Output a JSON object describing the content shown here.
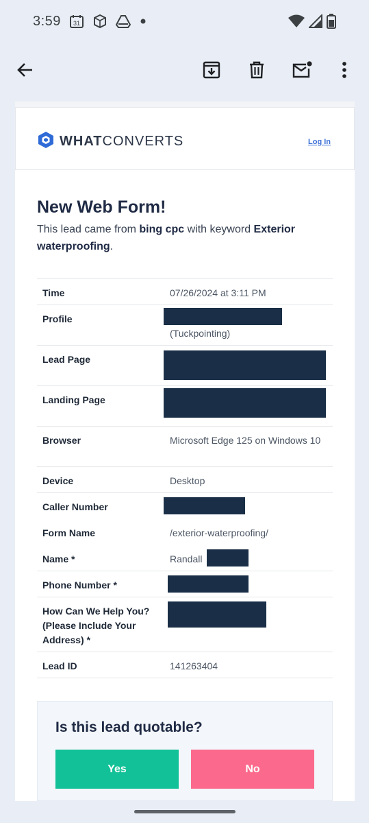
{
  "status_bar": {
    "time": "3:59",
    "calendar_day": "31",
    "icons": [
      "calendar-icon",
      "box-icon",
      "drive-icon",
      "dot-icon",
      "wifi-icon",
      "signal-icon",
      "battery-icon"
    ]
  },
  "toolbar": {
    "icons": [
      "back-arrow-icon",
      "archive-icon",
      "delete-icon",
      "mark-unread-icon",
      "more-vert-icon"
    ]
  },
  "header": {
    "brand_bold": "WHAT",
    "brand_rest": "CONVERTS",
    "login": "Log In"
  },
  "email": {
    "title": "New Web Form!",
    "intro_prefix": "This lead came from ",
    "source": "bing cpc",
    "intro_mid": " with keyword ",
    "keyword": "Exterior waterproofing",
    "intro_suffix": "."
  },
  "details": {
    "time_label": "Time",
    "time_value": "07/26/2024 at 3:11 PM",
    "profile_label": "Profile",
    "profile_value": "(Tuckpointing)",
    "lead_page_label": "Lead Page",
    "landing_page_label": "Landing Page",
    "browser_label": "Browser",
    "browser_value": "Microsoft Edge 125 on Windows 10",
    "device_label": "Device",
    "device_value": "Desktop",
    "caller_label": "Caller Number",
    "form_name_label": "Form Name",
    "form_name_value": "/exterior-waterproofing/",
    "name_label": "Name *",
    "name_value": "Randall",
    "phone_label": "Phone Number *",
    "help_label": "How Can We Help You? (Please Include Your Address) *",
    "lead_id_label": "Lead ID",
    "lead_id_value": "141263404"
  },
  "quote": {
    "title": "Is this lead quotable?",
    "yes": "Yes",
    "no": "No"
  },
  "colors": {
    "redaction": "#1a2f47",
    "yes_button": "#12c197",
    "no_button": "#fb6a8c",
    "brand_blue": "#2f6bd7",
    "toolbar_bg": "#e9eef6"
  }
}
